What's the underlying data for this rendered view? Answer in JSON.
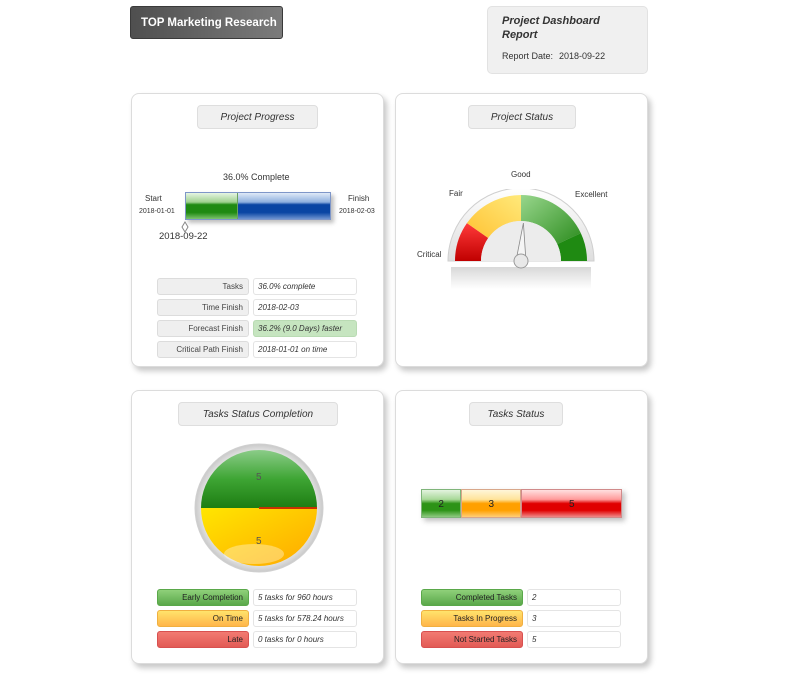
{
  "header": {
    "company_title": "TOP Marketing Research",
    "report_title": "Project Dashboard Report",
    "report_date_label": "Report Date:",
    "report_date": "2018-09-22"
  },
  "project_progress": {
    "title": "Project Progress",
    "percent_complete": 36.0,
    "complete_text": "36.0% Complete",
    "start_label": "Start",
    "start_date": "2018-01-01",
    "finish_label": "Finish",
    "finish_date": "2018-02-03",
    "current_date": "2018-09-22",
    "colors": {
      "done": "#1f8a12",
      "remaining": "#0a45a3"
    },
    "rows": [
      {
        "label": "Tasks",
        "value": "36.0% complete",
        "highlight": false
      },
      {
        "label": "Time Finish",
        "value": "2018-02-03",
        "highlight": false
      },
      {
        "label": "Forecast Finish",
        "value": "36.2% (9.0 Days) faster",
        "highlight": true
      },
      {
        "label": "Critical Path Finish",
        "value": "2018-01-01   on time",
        "highlight": false
      }
    ]
  },
  "project_status": {
    "title": "Project Status",
    "gauge_labels": [
      "Critical",
      "Fair",
      "Good",
      "Excellent"
    ],
    "needle_value": 0.52,
    "colors": {
      "critical": "#e00000",
      "fair": "#ffd24a",
      "good": "#7cc47a",
      "excellent": "#1f8a12"
    }
  },
  "tasks_status_completion": {
    "title": "Tasks Status Completion",
    "rows": [
      {
        "label": "Early Completion",
        "value": "5 tasks for 960 hours",
        "style": "green"
      },
      {
        "label": "On Time",
        "value": "5 tasks for 578.24 hours",
        "style": "yellow"
      },
      {
        "label": "Late",
        "value": "0 tasks for 0 hours",
        "style": "red"
      }
    ]
  },
  "tasks_status": {
    "title": "Tasks Status",
    "rows": [
      {
        "label": "Completed Tasks",
        "value": "2",
        "style": "green"
      },
      {
        "label": "Tasks In Progress",
        "value": "3",
        "style": "yellow"
      },
      {
        "label": "Not Started Tasks",
        "value": "5",
        "style": "red"
      }
    ]
  },
  "chart_data": [
    {
      "type": "pie",
      "title": "Tasks Status Completion",
      "categories": [
        "Early Completion",
        "On Time",
        "Late"
      ],
      "values": [
        5,
        5,
        0
      ],
      "colors": [
        "#2a9a1e",
        "#ffc400",
        "#c83200"
      ]
    },
    {
      "type": "bar",
      "title": "Tasks Status",
      "orientation": "horizontal-stacked",
      "categories": [
        "Completed Tasks",
        "Tasks In Progress",
        "Not Started Tasks"
      ],
      "values": [
        2,
        3,
        5
      ],
      "colors": [
        "#2d9317",
        "#ffa000",
        "#e00000"
      ]
    }
  ]
}
